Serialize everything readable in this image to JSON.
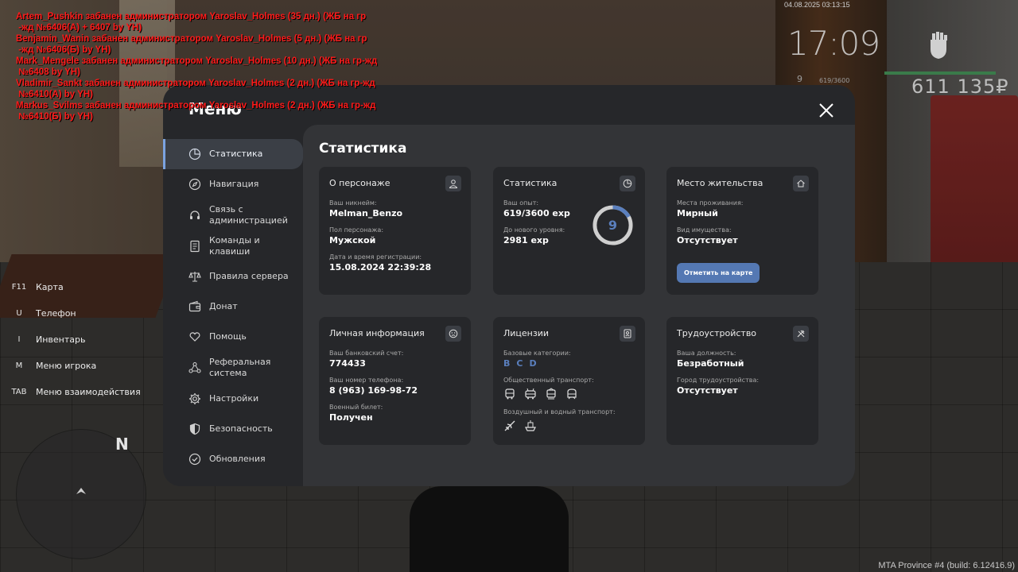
{
  "chat": [
    "Artem_Pushkin забанен администратором Yaroslav_Holmes (35 дн.) (ЖБ на гр\n -жд №6406(А) + 6407 by YH)",
    "Benjamin_Wanin забанен администратором Yaroslav_Holmes (5 дн.) (ЖБ на гр\n -жд №6406(Б) by YH)",
    "Mark_Mengele забанен администратором Yaroslav_Holmes (10 дн.) (ЖБ на гр-жд\n №6408 by YH)",
    "Vladimir_Sankt забанен администратором Yaroslav_Holmes (2 дн.) (ЖБ на гр-жд\n №6410(А) by YH)",
    "Markus_Svilms забанен администратором Yaroslav_Holmes (2 дн.) (ЖБ на гр-жд\n №6410(Б) by YH)"
  ],
  "hud": {
    "datetime": "04.08.2025 03:13:15",
    "clock": "17:09",
    "money": "611 135₽",
    "level": "9",
    "exp": "619/3600",
    "build": "MTA Province #4 (build: 6.12416.9)",
    "health_color": "#3a7b4a"
  },
  "hotkeys": [
    {
      "key": "F11",
      "label": "Карта"
    },
    {
      "key": "U",
      "label": "Телефон"
    },
    {
      "key": "I",
      "label": "Инвентарь"
    },
    {
      "key": "M",
      "label": "Меню игрока"
    },
    {
      "key": "TAB",
      "label": "Меню взаимодействия"
    }
  ],
  "minimap": {
    "north": "N"
  },
  "menu": {
    "title": "Меню",
    "accent": "#7ba3e0",
    "items": [
      {
        "label": "Статистика",
        "icon": "pie-chart-icon",
        "active": true
      },
      {
        "label": "Навигация",
        "icon": "compass-icon"
      },
      {
        "label": "Связь с\nадминистрацией",
        "icon": "headset-icon"
      },
      {
        "label": "Команды и клавиши",
        "icon": "document-icon"
      },
      {
        "label": "Правила сервера",
        "icon": "scales-icon"
      },
      {
        "label": "Донат",
        "icon": "wallet-icon"
      },
      {
        "label": "Помощь",
        "icon": "heart-hand-icon"
      },
      {
        "label": "Реферальная\nсистема",
        "icon": "network-icon"
      },
      {
        "label": "Настройки",
        "icon": "gear-icon"
      },
      {
        "label": "Безопасность",
        "icon": "shield-icon"
      },
      {
        "label": "Обновления",
        "icon": "check-circle-icon"
      }
    ]
  },
  "stats": {
    "heading": "Статистика",
    "character": {
      "title": "О персонаже",
      "nick_label": "Ваш никнейм:",
      "nick": "Melman_Benzo",
      "gender_label": "Пол персонажа:",
      "gender": "Мужской",
      "reg_label": "Дата и время регистрации:",
      "reg": "15.08.2024 22:39:28"
    },
    "statistics": {
      "title": "Статистика",
      "exp_label": "Ваш опыт:",
      "exp": "619/3600 exp",
      "next_label": "До нового уровня:",
      "next": "2981 exp",
      "level": "9",
      "progress": 0.172
    },
    "residence": {
      "title": "Место жительства",
      "place_label": "Места проживания:",
      "place": "Мирный",
      "prop_label": "Вид имущества:",
      "prop": "Отсутствует",
      "button": "Отметить на карте"
    },
    "personal": {
      "title": "Личная информация",
      "bank_label": "Ваш банковский счет:",
      "bank": "774433",
      "phone_label": "Ваш номер телефона:",
      "phone": "8 (963) 169-98-72",
      "military_label": "Военный билет:",
      "military": "Получен"
    },
    "licenses": {
      "title": "Лицензии",
      "base_label": "Базовые категории:",
      "base": [
        "B",
        "C",
        "D"
      ],
      "public_label": "Общественный транспорт:",
      "air_label": "Воздушный и водный транспорт:"
    },
    "employment": {
      "title": "Трудоустройство",
      "pos_label": "Ваша должность:",
      "pos": "Безработный",
      "city_label": "Город трудоустройства:",
      "city": "Отсутствует"
    }
  }
}
